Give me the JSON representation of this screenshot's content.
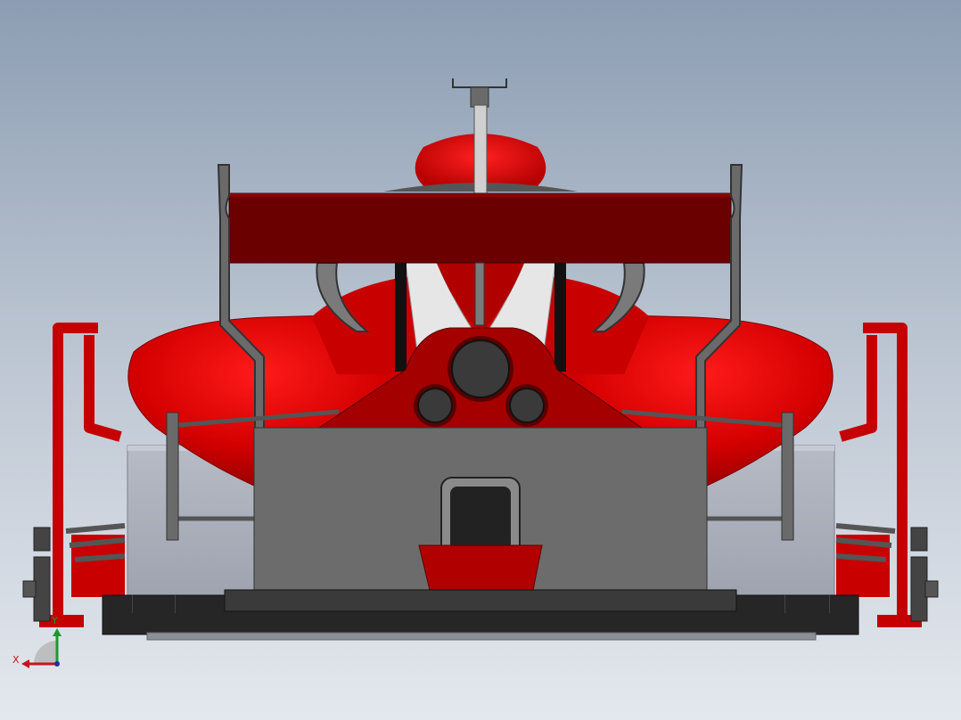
{
  "viewport": {
    "model": "formula-race-car-rear-view",
    "background": {
      "top": "#8c9db3",
      "bottom": "#e4e8ee"
    },
    "colors": {
      "body_red": "#cc0000",
      "body_red_dark": "#8b0000",
      "wing_maroon": "#6b0000",
      "diffuser_gray": "#6c6c6c",
      "steel_dark": "#3c3c3c",
      "wheel_gray": "#a9adb8",
      "floor_black": "#262626"
    }
  },
  "triad": {
    "x_label": "X",
    "y_label": "Y",
    "x_color": "#c8141e",
    "y_color": "#1a9a2c",
    "z_color": "#1f2f9c"
  }
}
